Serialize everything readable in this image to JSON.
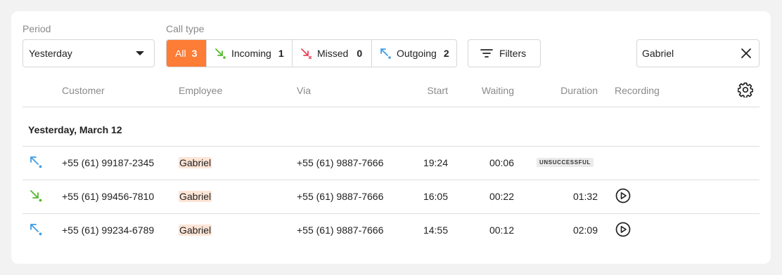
{
  "filters": {
    "period_label": "Period",
    "period_value": "Yesterday",
    "call_type_label": "Call type",
    "call_types": [
      {
        "label": "All",
        "count": "3"
      },
      {
        "label": "Incoming",
        "count": "1"
      },
      {
        "label": "Missed",
        "count": "0"
      },
      {
        "label": "Outgoing",
        "count": "2"
      }
    ],
    "filters_button": "Filters",
    "search_value": "Gabriel"
  },
  "columns": [
    "Customer",
    "Employee",
    "Via",
    "Start",
    "Waiting",
    "Duration",
    "Recording"
  ],
  "group_title": "Yesterday, March 12",
  "rows": [
    {
      "direction": "outgoing",
      "customer": "+55 (61) 99187-2345",
      "employee": "Gabriel",
      "via": "+55 (61) 9887-7666",
      "start": "19:24",
      "waiting": "00:06",
      "duration": "",
      "status": "UNSUCCESSFUL",
      "recording": false
    },
    {
      "direction": "incoming",
      "customer": "+55 (61) 99456-7810",
      "employee": "Gabriel",
      "via": "+55 (61) 9887-7666",
      "start": "16:05",
      "waiting": "00:22",
      "duration": "01:32",
      "status": "",
      "recording": true
    },
    {
      "direction": "outgoing",
      "customer": "+55 (61) 99234-6789",
      "employee": "Gabriel",
      "via": "+55 (61) 9887-7666",
      "start": "14:55",
      "waiting": "00:12",
      "duration": "02:09",
      "status": "",
      "recording": true
    }
  ],
  "colors": {
    "accent": "#fd7c36",
    "incoming": "#55b82b",
    "missed": "#e8445a",
    "outgoing": "#3d9de6",
    "highlight": "#fde5d6"
  },
  "icons": {
    "period_caret": "caret-down-icon",
    "incoming": "arrow-down-right-icon",
    "missed": "arrow-missed-icon",
    "outgoing": "arrow-up-left-icon",
    "filters": "filter-lines-icon",
    "clear": "close-icon",
    "settings": "gear-icon",
    "recording": "play-circle-icon"
  }
}
